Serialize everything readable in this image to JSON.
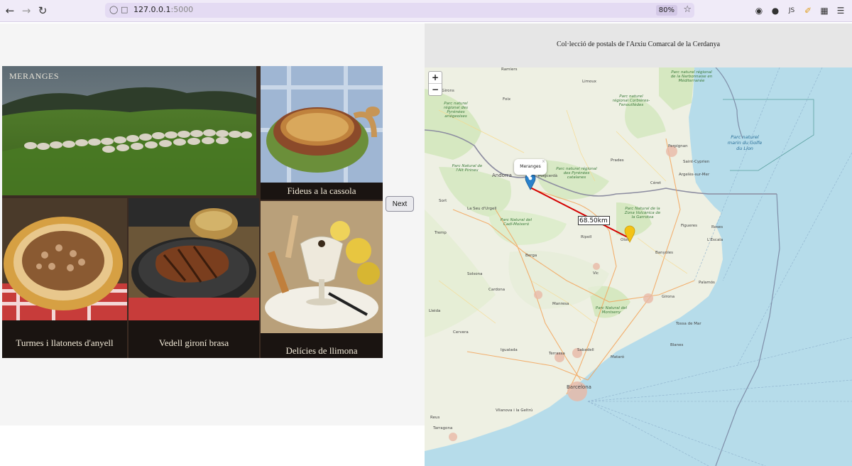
{
  "browser": {
    "url_host": "127.0.0.1",
    "url_port": ":5000",
    "zoom": "80%"
  },
  "postcard": {
    "title": "MERANGES",
    "captions": [
      "Fideus a la cassola",
      "Turmes i llatonets d'anyell",
      "Vedell gironí brasa",
      "Delícies de llimona"
    ]
  },
  "controls": {
    "next_label": "Next"
  },
  "map": {
    "title": "Col·lecció de postals de l'Arxiu Comarcal de la Cerdanya",
    "zoom_in": "+",
    "zoom_out": "−",
    "popup_text": "Meranges",
    "popup_close": "×",
    "distance": "68.50km",
    "colors": {
      "distance_line": "#d40000",
      "marker_blue": "#2a81cb",
      "marker_yellow": "#f3c316",
      "water": "#b6dcea",
      "land": "#f2efe9",
      "park": "#cde6b8"
    },
    "places": {
      "ramiers": "Ramiers",
      "saint_girons": "Saint-Girons",
      "foix": "Foix",
      "limoux": "Limoux",
      "perpignan": "Perpignan",
      "prades": "Prades",
      "andorra": "Andorra",
      "puigcerda": "Puigcerdà",
      "la_seu": "La Seu d'Urgell",
      "ripoll": "Ripoll",
      "olot": "Olot",
      "figueres": "Figueres",
      "girona": "Girona",
      "vic": "Vic",
      "manresa": "Manresa",
      "berga": "Berga",
      "terrassa": "Terrassa",
      "sabadell": "Sabadell",
      "mataro": "Mataró",
      "barcelona": "Barcelona",
      "tarragona": "Tarragona",
      "lleida": "Lleida",
      "solsona": "Solsona",
      "cardona": "Cardona",
      "igualada": "Igualada",
      "banyoles": "Banyoles",
      "roses": "Roses",
      "palamos": "Palamós",
      "blanes": "Blanes",
      "sant_cyprien": "Saint-Cyprien",
      "cervera": "Cervera",
      "vilanova": "Vilanova i la Geltrú",
      "reus": "Reus",
      "lescala": "L'Escala",
      "tossa": "Tossa de Mar",
      "argeles": "Argelès-sur-Mer",
      "sort": "Sort",
      "tremp": "Tremp",
      "ceret": "Céret"
    },
    "parks": {
      "pyrenees_ariegeoises": "Parc naturel régional des Pyrénées ariégeoises",
      "corbieres": "Parc naturel régional Corbières-Fenouillèdes",
      "narbonnaise": "Parc naturel régional de la Narbonnaise en Méditerranée",
      "pyrenees_catalanes": "Parc naturel régional des Pyrénées catalanes",
      "alt_pirineu": "Parc Natural de l'Alt Pirineu",
      "cadi": "Parc Natural del Cadí-Moixeró",
      "montseny": "Parc Natural del Montseny",
      "garrotxa": "Parc Natural de la Zona Volcànica de la Garrotxa",
      "marin": "Parc naturel marin du Golfe du Lion"
    }
  }
}
